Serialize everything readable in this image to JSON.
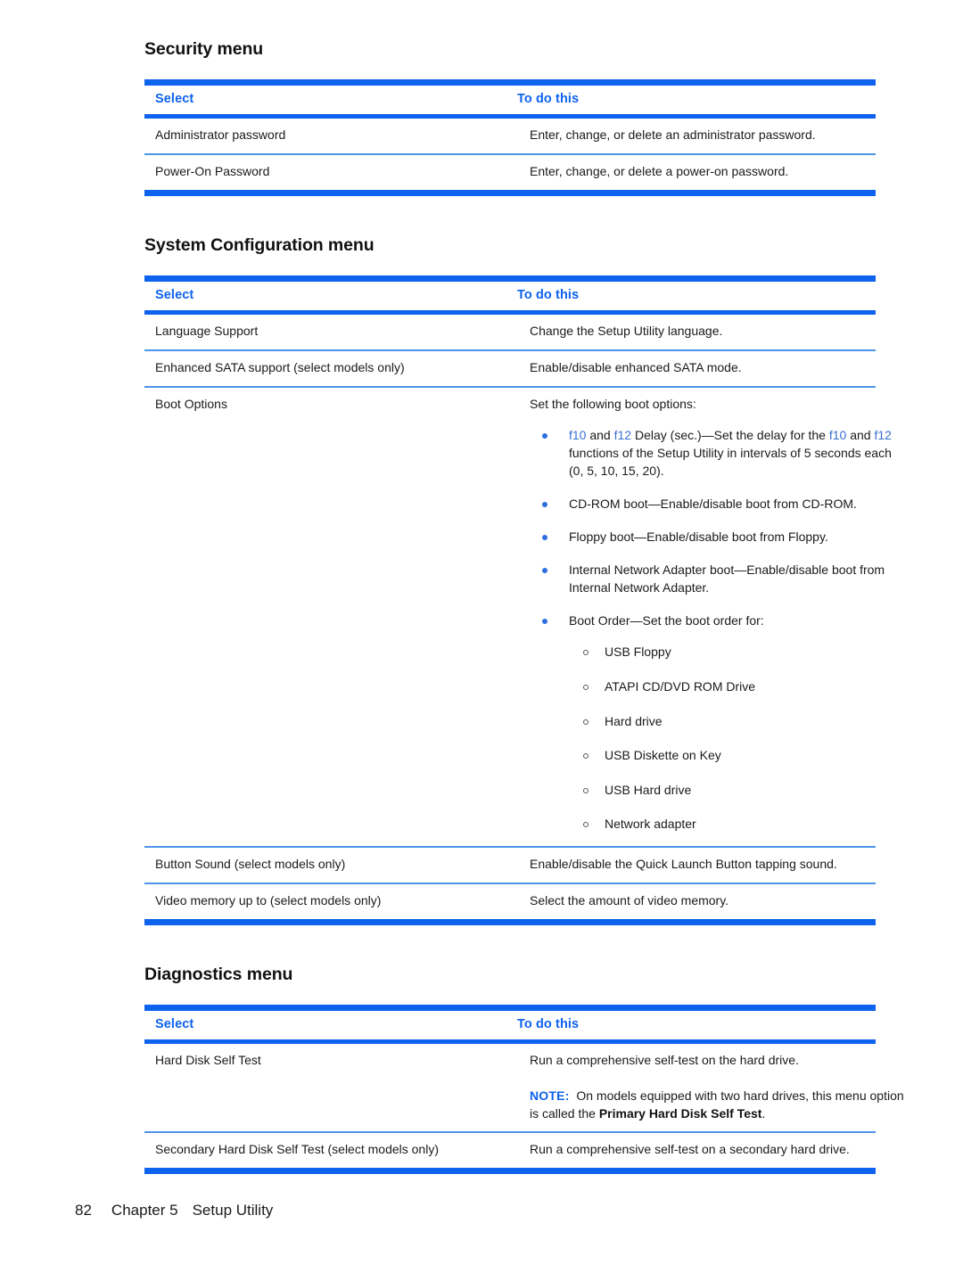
{
  "page": {
    "number": "82",
    "chapter": "Chapter 5",
    "chapter_title": "Setup Utility"
  },
  "colors": {
    "rule_blue": "#0D62EE",
    "rule_thin_blue": "#4D94E8",
    "heading_blue": "#0D62EE",
    "key_blue": "#3A6FD0",
    "bullet_blue": "#2C6FE0"
  },
  "sections": [
    {
      "title": "Security menu",
      "columns": {
        "select": "Select",
        "todo": "To do this"
      },
      "rows": [
        {
          "select": "Administrator password",
          "todo": "Enter, change, or delete an administrator password."
        },
        {
          "select": "Power-On Password",
          "todo": "Enter, change, or delete a power-on password."
        }
      ]
    },
    {
      "title": "System Configuration menu",
      "columns": {
        "select": "Select",
        "todo": "To do this"
      },
      "rows": [
        {
          "select": "Language Support",
          "todo": "Change the Setup Utility language."
        },
        {
          "select": "Enhanced SATA support (select models only)",
          "todo": "Enable/disable enhanced SATA mode."
        },
        {
          "select": "Boot Options",
          "todo": "Set the following boot options:",
          "bullets": [
            {
              "prefix_key_a": "f10",
              "mid_a": " and ",
              "prefix_key_b": "f12",
              "mid_b": " Delay (sec.)—Set the delay for the ",
              "key_c": "f10",
              "mid_c": " and ",
              "key_d": "f12",
              "tail": " functions of the Setup Utility in intervals of 5 seconds each (0, 5, 10, 15, 20)."
            },
            {
              "text": "CD-ROM boot—Enable/disable boot from CD-ROM."
            },
            {
              "text": "Floppy boot—Enable/disable boot from Floppy."
            },
            {
              "text": "Internal Network Adapter boot—Enable/disable boot from Internal Network Adapter."
            },
            {
              "text": "Boot Order—Set the boot order for:",
              "sub": [
                "USB Floppy",
                "ATAPI CD/DVD ROM Drive",
                "Hard drive",
                "USB Diskette on Key",
                "USB Hard drive",
                "Network adapter"
              ]
            }
          ]
        },
        {
          "select": "Button Sound (select models only)",
          "todo": "Enable/disable the Quick Launch Button tapping sound."
        },
        {
          "select": "Video memory up to (select models only)",
          "todo": "Select the amount of video memory."
        }
      ]
    },
    {
      "title": "Diagnostics menu",
      "columns": {
        "select": "Select",
        "todo": "To do this"
      },
      "rows": [
        {
          "select": "Hard Disk Self Test",
          "todo": "Run a comprehensive self-test on the hard drive.",
          "note": {
            "label": "NOTE:",
            "text_before": "On models equipped with two hard drives, this menu option is called the ",
            "bold": "Primary Hard Disk Self Test",
            "text_after": "."
          }
        },
        {
          "select": "Secondary Hard Disk Self Test (select models only)",
          "todo": "Run a comprehensive self-test on a secondary hard drive."
        }
      ]
    }
  ]
}
